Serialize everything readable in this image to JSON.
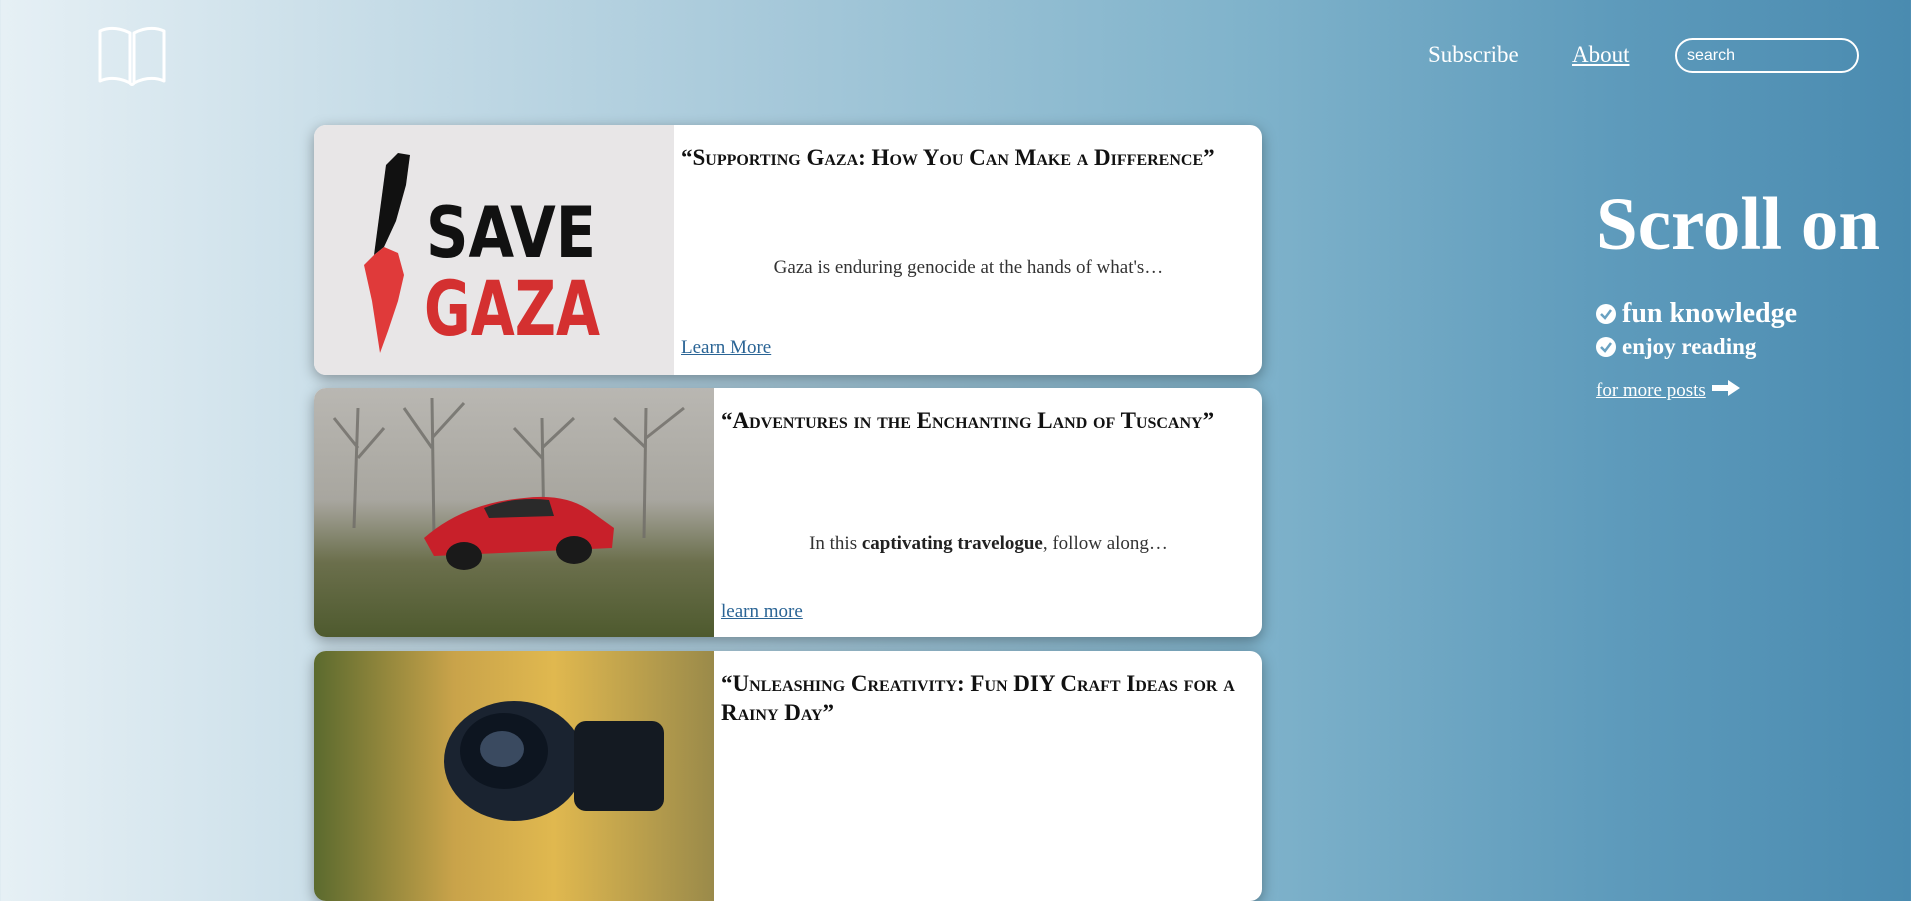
{
  "nav": {
    "subscribe_label": "Subscribe",
    "about_label": "About",
    "search_placeholder": "search",
    "logo_icon": "open-book-icon"
  },
  "posts": [
    {
      "title": "“Supporting Gaza: How You Can Make a Difference”",
      "image_text": [
        "SAVE",
        "GAZA"
      ],
      "excerpt_pre": "Gaza is enduring genocide at the hands of what's…",
      "link_label": "Learn More"
    },
    {
      "title": "“Adventures in the Enchanting Land of Tuscany”",
      "excerpt_pre": "In this ",
      "excerpt_bold": "captivating travelogue",
      "excerpt_post": ", follow along…",
      "link_label": "learn more"
    },
    {
      "title": "“Unleashing Creativity: Fun DIY Craft Ideas for a Rainy Day”"
    }
  ],
  "sidebar": {
    "title": "Scroll on",
    "features": [
      "fun knowledge",
      "enjoy reading"
    ],
    "more_posts_label": "for more posts ",
    "check_icon": "check-circle-icon",
    "arrow_icon": "arrow-right-icon"
  },
  "colors": {
    "link": "#2a6495",
    "bg_start": "#e6f0f5",
    "bg_end": "#4a8bb0"
  }
}
